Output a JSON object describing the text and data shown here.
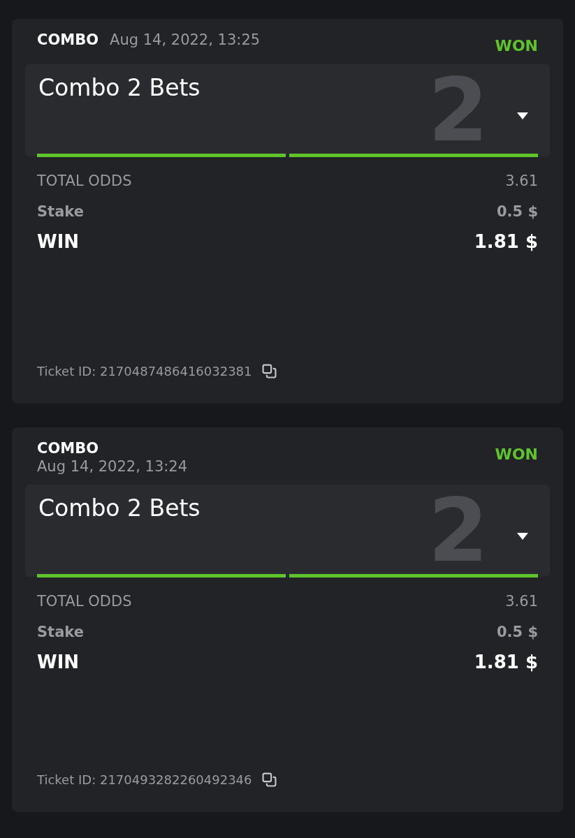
{
  "tickets": [
    {
      "type": "COMBO",
      "date": "Aug 14, 2022, 13:25",
      "kind": "inline",
      "status": "WON",
      "won": true,
      "title": "Combo 2 Bets",
      "count": "2",
      "legs": [
        {
          "won": true
        },
        {
          "won": true
        }
      ],
      "total_odds_label": "TOTAL ODDS",
      "total_odds": "3.61",
      "stake_label": "Stake",
      "stake": "0.5 $",
      "win_label": "WIN",
      "win": "1.81 $",
      "ticket_id": "Ticket ID: 2170487486416032381"
    },
    {
      "type": "COMBO",
      "date": "Aug 14, 2022, 13:24",
      "kind": "stacked",
      "status": "WON",
      "won": true,
      "title": "Combo 2 Bets",
      "count": "2",
      "legs": [
        {
          "won": true
        },
        {
          "won": true
        }
      ],
      "total_odds_label": "TOTAL ODDS",
      "total_odds": "3.61",
      "stake_label": "Stake",
      "stake": "0.5 $",
      "win_label": "WIN",
      "win": "1.81 $",
      "ticket_id": "Ticket ID: 2170493282260492346"
    }
  ]
}
